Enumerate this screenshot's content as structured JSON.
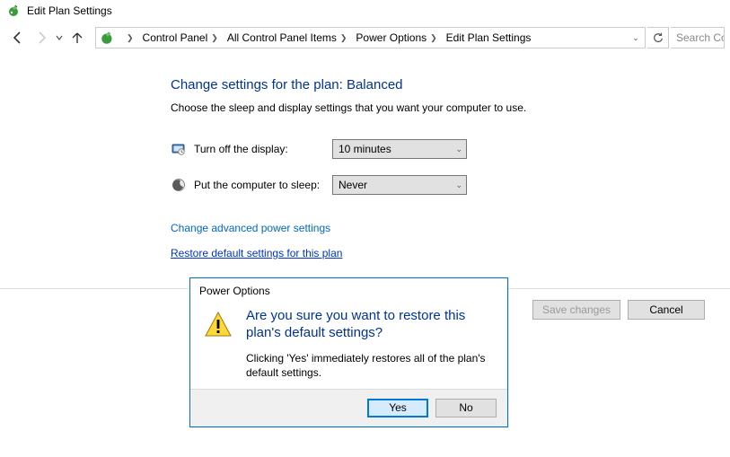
{
  "window": {
    "title": "Edit Plan Settings"
  },
  "breadcrumb": {
    "items": [
      {
        "label": "Control Panel"
      },
      {
        "label": "All Control Panel Items"
      },
      {
        "label": "Power Options"
      },
      {
        "label": "Edit Plan Settings"
      }
    ]
  },
  "search": {
    "placeholder": "Search Cor"
  },
  "page": {
    "heading": "Change settings for the plan: Balanced",
    "subtext": "Choose the sleep and display settings that you want your computer to use.",
    "settings": [
      {
        "label": "Turn off the display:",
        "value": "10 minutes"
      },
      {
        "label": "Put the computer to sleep:",
        "value": "Never"
      }
    ],
    "link_advanced": "Change advanced power settings",
    "link_restore": "Restore default settings for this plan",
    "save_btn": "Save changes",
    "cancel_btn": "Cancel"
  },
  "dialog": {
    "title": "Power Options",
    "main": "Are you sure you want to restore this plan's default settings?",
    "sub": "Clicking 'Yes' immediately restores all of the plan's default settings.",
    "yes": "Yes",
    "no": "No"
  }
}
